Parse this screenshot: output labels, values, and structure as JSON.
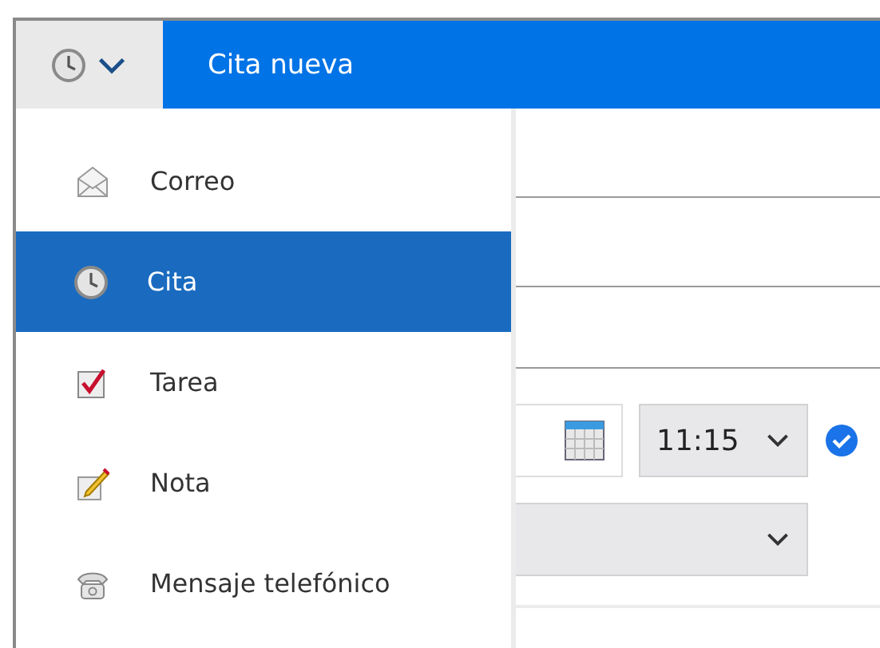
{
  "header": {
    "title": "Cita nueva"
  },
  "menu": {
    "expanded": true,
    "items": [
      {
        "kind": "mail",
        "label": "Correo",
        "selected": false
      },
      {
        "kind": "appointment",
        "label": "Cita",
        "selected": true
      },
      {
        "kind": "task",
        "label": "Tarea",
        "selected": false
      },
      {
        "kind": "note",
        "label": "Nota",
        "selected": false
      },
      {
        "kind": "phone",
        "label": "Mensaje telefónico",
        "selected": false
      }
    ]
  },
  "form": {
    "start_time": "11:15",
    "confirmed": true
  }
}
